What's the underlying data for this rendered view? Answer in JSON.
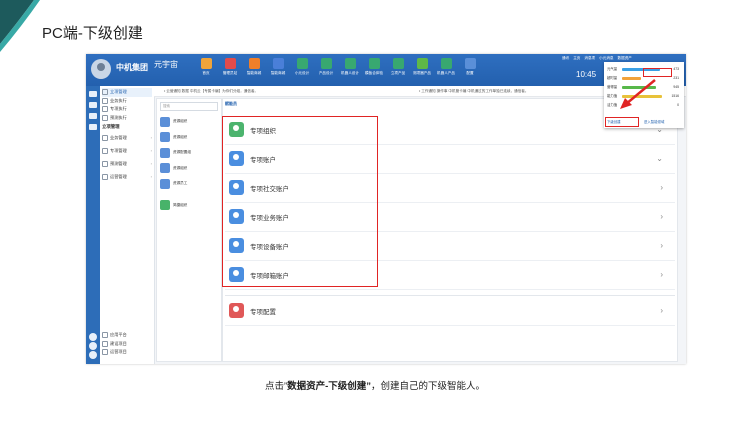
{
  "slide": {
    "title": "PC端-下级创建",
    "caption_prefix": "点击”",
    "caption_bold": "数据资产-下级创建”",
    "caption_suffix": "，创建自己的下级智能人。"
  },
  "app": {
    "brand": "中机集团",
    "brand_sub": "",
    "user": "元宇宙",
    "user_sub": "",
    "clock": "10:45",
    "nav": [
      {
        "label": "首页",
        "color": "#f0a43a"
      },
      {
        "label": "管理员站",
        "color": "#e24b4b"
      },
      {
        "label": "智能商城",
        "color": "#f07f2a"
      },
      {
        "label": "智能商城",
        "color": "#4a7fd8"
      },
      {
        "label": "小元设计",
        "color": "#38a870"
      },
      {
        "label": "产品设计",
        "color": "#38a870"
      },
      {
        "label": "机器人设计",
        "color": "#38a870"
      },
      {
        "label": "模板合体验",
        "color": "#38a870"
      },
      {
        "label": "立项产品",
        "color": "#38a870"
      },
      {
        "label": "测项器产品",
        "color": "#5fb848"
      },
      {
        "label": "机器人产品",
        "color": "#38a870"
      },
      {
        "label": "配置",
        "color": "#5a8fd8"
      }
    ],
    "top_links": [
      "通讯",
      "主页",
      "消息项",
      "小元消息",
      "数据资产"
    ]
  },
  "sidebar": {
    "items": [
      {
        "label": "立项管理",
        "active": true
      },
      {
        "label": "业务执行"
      },
      {
        "label": "专项执行"
      },
      {
        "label": "预测执行"
      }
    ],
    "head": "立项管理",
    "groups": [
      {
        "label": "业务管理"
      },
      {
        "label": "专项管理"
      },
      {
        "label": "预测管理"
      },
      {
        "label": "运营管理"
      }
    ],
    "bottom": [
      {
        "label": "应用平台"
      },
      {
        "label": "建设项目"
      },
      {
        "label": "运营项目"
      }
    ]
  },
  "notice": {
    "left": "• 云营通知 数据 中机云【专属卡编】为你们分组，通信者。",
    "right": "• 工作通知 操作事 中机管卡编 中机通过的工作单独已连续，通信者。"
  },
  "middle": {
    "search_placeholder": "搜索",
    "items": [
      {
        "label": "资源组织",
        "color": "#5b8fd8"
      },
      {
        "label": "资源组织",
        "color": "#5b8fd8"
      },
      {
        "label": "资源配置组",
        "color": "#5b8fd8"
      },
      {
        "label": "资源组织",
        "color": "#5b8fd8"
      },
      {
        "label": "资源员工",
        "color": "#5b8fd8"
      },
      {
        "label": "简捷组织",
        "color": "#48b36a"
      }
    ]
  },
  "right": {
    "crumb": "赋能员",
    "rows": [
      {
        "label": "专项组织",
        "color": "#4cb46e",
        "chev": "⌄"
      },
      {
        "label": "专项账户",
        "color": "#4a8ee0",
        "chev": "⌄"
      },
      {
        "label": "专项社交账户",
        "color": "#4a8ee0",
        "chev": "›"
      },
      {
        "label": "专项业务账户",
        "color": "#4a8ee0",
        "chev": "›"
      },
      {
        "label": "专项设备账户",
        "color": "#4a8ee0",
        "chev": "›"
      },
      {
        "label": "专项邮箱账户",
        "color": "#4a8ee0",
        "chev": "›"
      },
      {
        "label": "专项配置",
        "color": "#e05858",
        "chev": "›"
      }
    ]
  },
  "dropdown": {
    "rows": [
      {
        "label": "元气量",
        "value": "473",
        "color": "#3aa0e6",
        "fraction": 0.9
      },
      {
        "label": "超时量",
        "value": "231",
        "color": "#f2a23a",
        "fraction": 0.45
      },
      {
        "label": "营得量",
        "value": "945",
        "color": "#58b84a",
        "fraction": 0.8
      },
      {
        "label": "能力值",
        "value": "1516",
        "color": "#e8c23a",
        "fraction": 0.95
      },
      {
        "label": "活力值",
        "value": "0",
        "color": "#cccccc",
        "fraction": 0.0
      }
    ],
    "btn_left": "下级创建",
    "btn_right": "进入智能领域"
  }
}
